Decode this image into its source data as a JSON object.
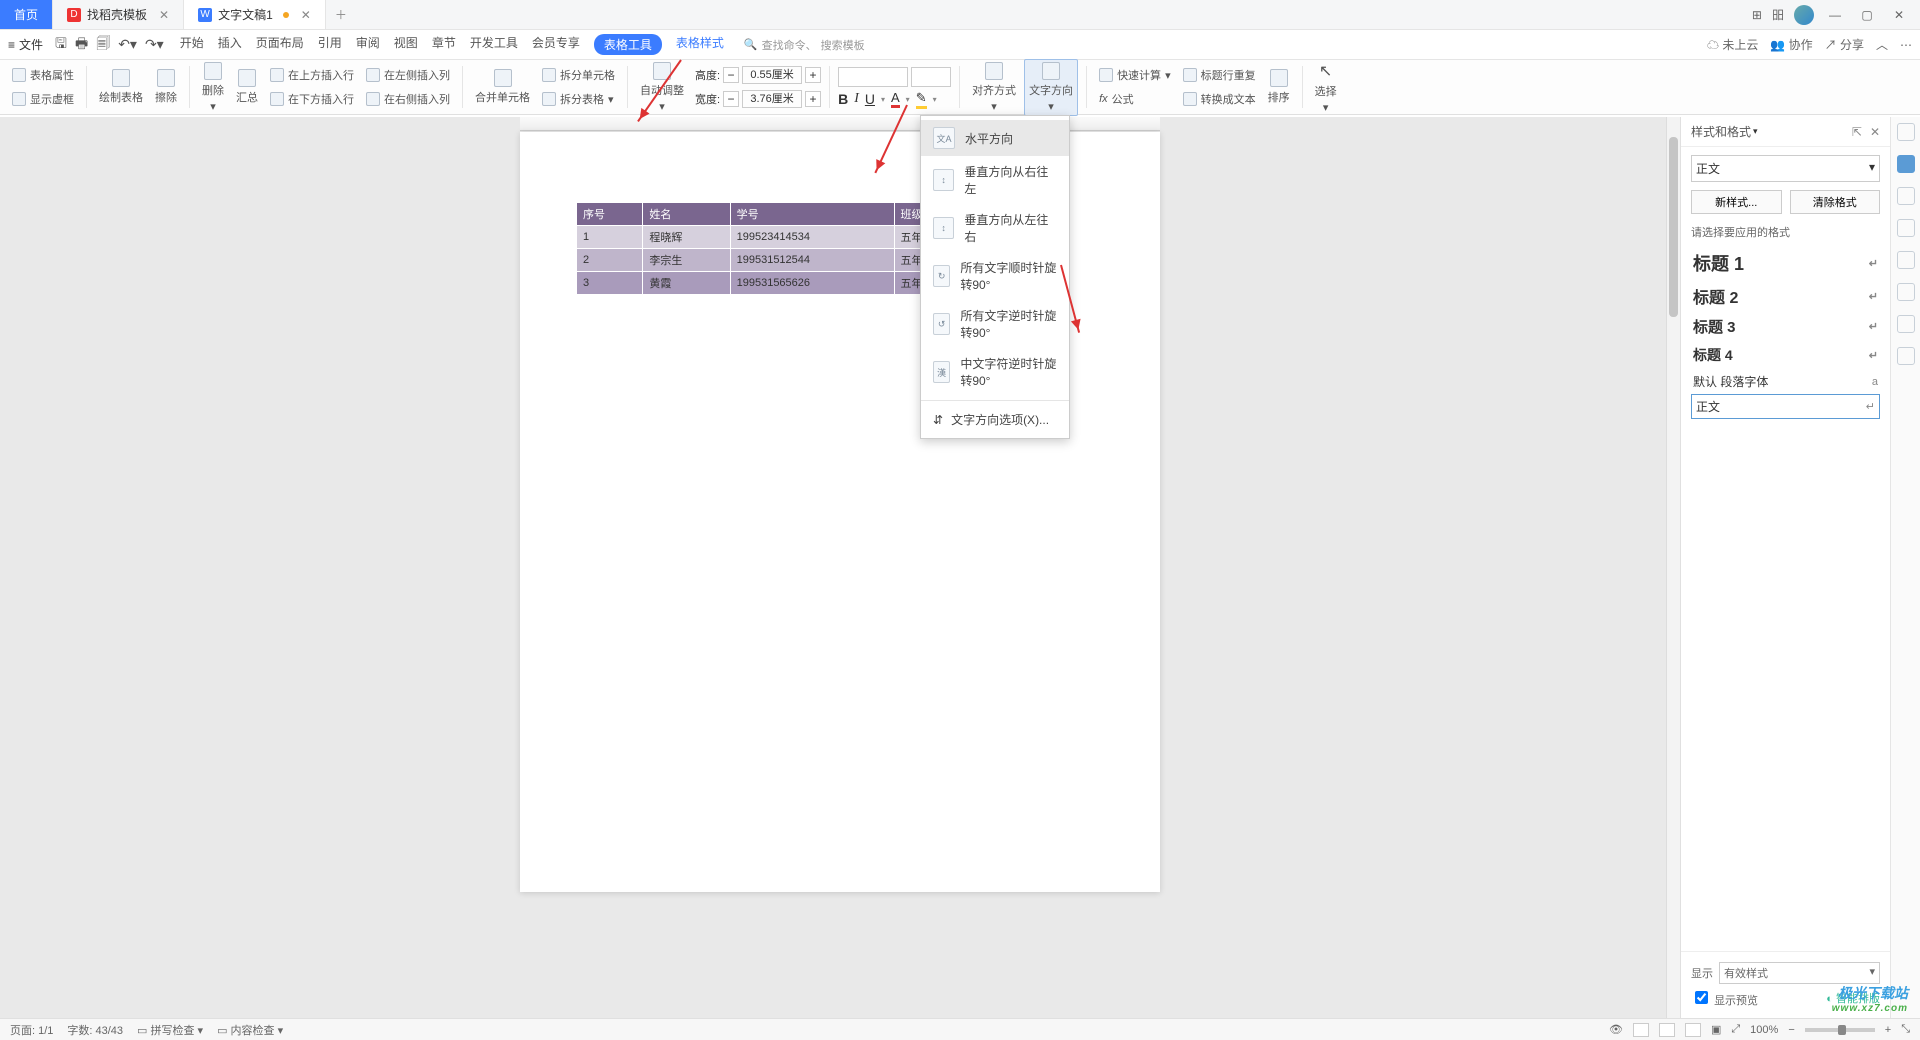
{
  "tabs": {
    "home": "首页",
    "templates": "找稻壳模板",
    "doc": "文字文稿1"
  },
  "titleRight": {
    "grid": "⊞",
    "apps": "昍"
  },
  "menubar": {
    "file": "文件",
    "menus": [
      "开始",
      "插入",
      "页面布局",
      "引用",
      "审阅",
      "视图",
      "章节",
      "开发工具",
      "会员专享"
    ],
    "active": "表格工具",
    "link": "表格样式",
    "searchIcon": "查找命令、",
    "searchPh": "搜索模板",
    "cloud": "未上云",
    "coop": "协作",
    "share": "分享"
  },
  "ribbon": {
    "tableProp": "表格属性",
    "showDash": "显示虚框",
    "drawTable": "绘制表格",
    "erase": "擦除",
    "delete": "删除",
    "sum": "汇总",
    "insAbove": "在上方插入行",
    "insBelow": "在下方插入行",
    "insLeft": "在左侧插入列",
    "insRight": "在右侧插入列",
    "merge": "合并单元格",
    "splitCell": "拆分单元格",
    "splitTable": "拆分表格",
    "autofit": "自动调整",
    "heightLbl": "高度:",
    "heightVal": "0.55厘米",
    "widthLbl": "宽度:",
    "widthVal": "3.76厘米",
    "align": "对齐方式",
    "textDir": "文字方向",
    "quickCalc": "快速计算",
    "formula": "公式",
    "repeatHead": "标题行重复",
    "toText": "转换成文本",
    "sort": "排序",
    "select": "选择"
  },
  "dropdown": {
    "items": [
      "水平方向",
      "垂直方向从右往左",
      "垂直方向从左往右",
      "所有文字顺时针旋转90°",
      "所有文字逆时针旋转90°",
      "中文字符逆时针旋转90°"
    ],
    "opt": "文字方向选项(X)..."
  },
  "table": {
    "headers": [
      "序号",
      "姓名",
      "学号",
      "班级"
    ],
    "rows": [
      [
        "1",
        "程晓辉",
        "199523414534",
        "五年级（1）班"
      ],
      [
        "2",
        "李宗生",
        "199531512544",
        "五年级（2）班"
      ],
      [
        "3",
        "黄霞",
        "199531565626",
        "五年级（3）班"
      ]
    ]
  },
  "stylesPane": {
    "title": "样式和格式",
    "current": "正文",
    "newStyle": "新样式...",
    "clear": "清除格式",
    "prompt": "请选择要应用的格式",
    "items": [
      {
        "label": "标题 1",
        "cls": "h1"
      },
      {
        "label": "标题 2",
        "cls": "h2"
      },
      {
        "label": "标题 3",
        "cls": "h3"
      },
      {
        "label": "标题 4",
        "cls": "h4"
      }
    ],
    "defaultFont": "默认 段落字体",
    "body": "正文",
    "showLbl": "显示",
    "showVal": "有效样式",
    "preview": "显示预览",
    "smart": "智能排版"
  },
  "status": {
    "page": "页面: 1/1",
    "words": "字数: 43/43",
    "spell": "拼写检查",
    "docCheck": "内容检查",
    "zoom": "100%"
  },
  "watermark": {
    "l1": "极光下载站",
    "l2": "www.xz7.com"
  }
}
